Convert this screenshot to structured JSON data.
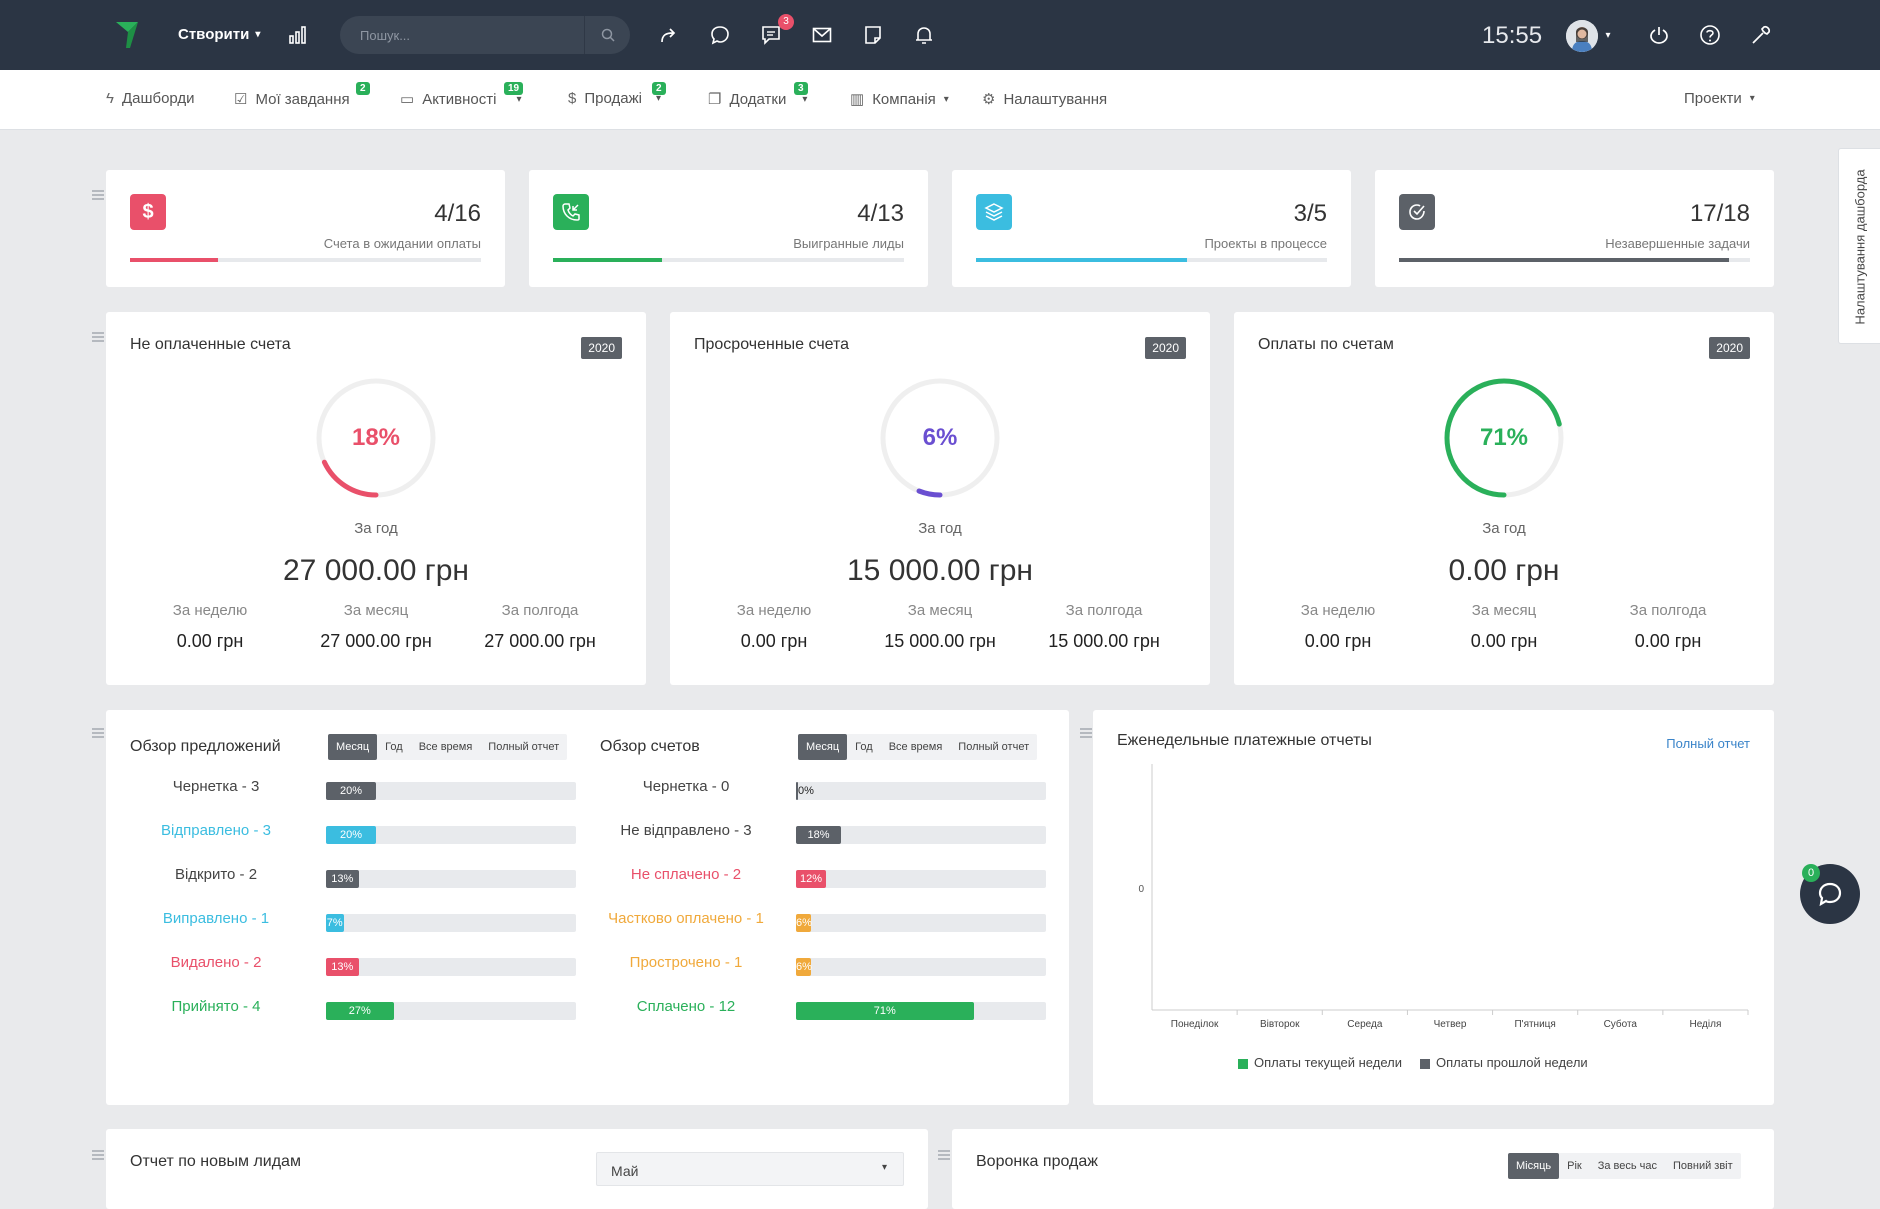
{
  "topbar": {
    "create_label": "Створити",
    "search_placeholder": "Пошук...",
    "chat_badge": "3",
    "time": "15:55"
  },
  "nav": {
    "items": [
      {
        "label": "Дашборди",
        "badge": ""
      },
      {
        "label": "Мої завдання",
        "badge": "2"
      },
      {
        "label": "Активності",
        "badge": "19"
      },
      {
        "label": "Продажі",
        "badge": "2"
      },
      {
        "label": "Додатки",
        "badge": "3"
      },
      {
        "label": "Компанія",
        "badge": ""
      },
      {
        "label": "Налаштування",
        "badge": ""
      }
    ],
    "projects": "Проекти"
  },
  "stats": [
    {
      "value": "4/16",
      "label": "Счета в ожидании оплаты",
      "progress": 0.25,
      "color": "#e9506a"
    },
    {
      "value": "4/13",
      "label": "Выигранные лиды",
      "progress": 0.31,
      "color": "#2ab05a"
    },
    {
      "value": "3/5",
      "label": "Проекты в процессе",
      "progress": 0.6,
      "color": "#3bbde0"
    },
    {
      "value": "17/18",
      "label": "Незавершенные задачи",
      "progress": 0.94,
      "color": "#5c6168"
    }
  ],
  "invoice_cards": [
    {
      "title": "Не оплаченные счета",
      "year": "2020",
      "percent_label": "18%",
      "percent": 18,
      "color": "#e9506a",
      "period_label": "За год",
      "total": "27 000.00 грн",
      "week_label": "За неделю",
      "week": "0.00 грн",
      "month_label": "За месяц",
      "month": "27 000.00 грн",
      "half_label": "За полгода",
      "half": "27 000.00 грн"
    },
    {
      "title": "Просроченные счета",
      "year": "2020",
      "percent_label": "6%",
      "percent": 6,
      "color": "#6a4fd1",
      "period_label": "За год",
      "total": "15 000.00 грн",
      "week_label": "За неделю",
      "week": "0.00 грн",
      "month_label": "За месяц",
      "month": "15 000.00 грн",
      "half_label": "За полгода",
      "half": "15 000.00 грн"
    },
    {
      "title": "Оплаты по счетам",
      "year": "2020",
      "percent_label": "71%",
      "percent": 71,
      "color": "#2ab05a",
      "period_label": "За год",
      "total": "0.00 грн",
      "week_label": "За неделю",
      "week": "0.00 грн",
      "month_label": "За месяц",
      "month": "0.00 грн",
      "half_label": "За полгода",
      "half": "0.00 грн"
    }
  ],
  "proposals": {
    "title": "Обзор предложений",
    "tabs": [
      "Месяц",
      "Год",
      "Все время",
      "Полный отчет"
    ],
    "rows": [
      {
        "label": "Чернетка - 3",
        "pct": 20,
        "pct_label": "20%",
        "color": "#5c6168",
        "text_color": "#444"
      },
      {
        "label": "Відправлено - 3",
        "pct": 20,
        "pct_label": "20%",
        "color": "#3bbde0",
        "text_color": "#3bbde0"
      },
      {
        "label": "Відкрито - 2",
        "pct": 13,
        "pct_label": "13%",
        "color": "#5c6168",
        "text_color": "#444"
      },
      {
        "label": "Виправлено - 1",
        "pct": 7,
        "pct_label": "7%",
        "color": "#3bbde0",
        "text_color": "#3bbde0"
      },
      {
        "label": "Видалено - 2",
        "pct": 13,
        "pct_label": "13%",
        "color": "#e9506a",
        "text_color": "#e9506a"
      },
      {
        "label": "Прийнято - 4",
        "pct": 27,
        "pct_label": "27%",
        "color": "#2ab05a",
        "text_color": "#2ab05a"
      }
    ]
  },
  "invoices_overview": {
    "title": "Обзор счетов",
    "tabs": [
      "Месяц",
      "Год",
      "Все время",
      "Полный отчет"
    ],
    "rows": [
      {
        "label": "Чернетка - 0",
        "pct": 0,
        "pct_label": "0%",
        "color": "#5c6168",
        "text_color": "#444"
      },
      {
        "label": "Не відправлено - 3",
        "pct": 18,
        "pct_label": "18%",
        "color": "#5c6168",
        "text_color": "#444"
      },
      {
        "label": "Не сплачено - 2",
        "pct": 12,
        "pct_label": "12%",
        "color": "#e9506a",
        "text_color": "#e9506a"
      },
      {
        "label": "Частково оплачено - 1",
        "pct": 6,
        "pct_label": "6%",
        "color": "#f0a93b",
        "text_color": "#f0a93b"
      },
      {
        "label": "Прострочено - 1",
        "pct": 6,
        "pct_label": "6%",
        "color": "#f0a93b",
        "text_color": "#f0a93b"
      },
      {
        "label": "Сплачено - 12",
        "pct": 71,
        "pct_label": "71%",
        "color": "#2ab05a",
        "text_color": "#2ab05a"
      }
    ]
  },
  "weekly": {
    "title": "Еженедельные платежные отчеты",
    "full_report": "Полный отчет",
    "chart_data": {
      "type": "bar",
      "categories": [
        "Понеділок",
        "Вівторок",
        "Середа",
        "Четвер",
        "П'ятниця",
        "Субота",
        "Неділя"
      ],
      "series": [
        {
          "name": "Оплаты текущей недели",
          "values": [
            0,
            0,
            0,
            0,
            0,
            0,
            0
          ],
          "color": "#2ab05a"
        },
        {
          "name": "Оплаты прошлой недели",
          "values": [
            0,
            0,
            0,
            0,
            0,
            0,
            0
          ],
          "color": "#5c6168"
        }
      ],
      "y_tick": "0"
    }
  },
  "bottom": {
    "leads_title": "Отчет по новым лидам",
    "leads_select": "Май",
    "funnel_title": "Воронка продаж",
    "funnel_tabs": [
      "Місяць",
      "Рік",
      "За весь час",
      "Повний звіт"
    ]
  },
  "side_tab": "Налаштування дашборда",
  "chat_badge": "0"
}
